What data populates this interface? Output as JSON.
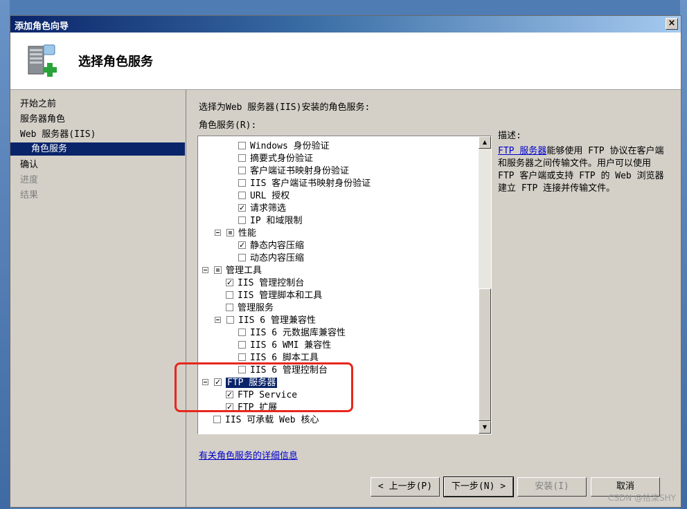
{
  "window": {
    "title": "添加角色向导",
    "close_label": "×"
  },
  "header": {
    "title": "选择角色服务"
  },
  "nav": {
    "items": [
      {
        "label": "开始之前",
        "state": "normal"
      },
      {
        "label": "服务器角色",
        "state": "normal"
      },
      {
        "label": "Web 服务器(IIS)",
        "state": "normal"
      },
      {
        "label": "角色服务",
        "state": "active"
      },
      {
        "label": "确认",
        "state": "normal"
      },
      {
        "label": "进度",
        "state": "disabled"
      },
      {
        "label": "结果",
        "state": "disabled"
      }
    ]
  },
  "main": {
    "intro": "选择为Web 服务器(IIS)安装的角色服务:",
    "tree_label": "角色服务(R):",
    "tree": [
      {
        "label": "Windows 身份验证",
        "state": "unchecked"
      },
      {
        "label": "摘要式身份验证",
        "state": "unchecked"
      },
      {
        "label": "客户端证书映射身份验证",
        "state": "unchecked"
      },
      {
        "label": "IIS 客户端证书映射身份验证",
        "state": "unchecked"
      },
      {
        "label": "URL 授权",
        "state": "unchecked"
      },
      {
        "label": "请求筛选",
        "state": "checked"
      },
      {
        "label": "IP 和域限制",
        "state": "unchecked"
      },
      {
        "label": "性能",
        "state": "partial"
      },
      {
        "label": "静态内容压缩",
        "state": "checked"
      },
      {
        "label": "动态内容压缩",
        "state": "unchecked"
      },
      {
        "label": "管理工具",
        "state": "partial"
      },
      {
        "label": "IIS 管理控制台",
        "state": "checked"
      },
      {
        "label": "IIS 管理脚本和工具",
        "state": "unchecked"
      },
      {
        "label": "管理服务",
        "state": "unchecked"
      },
      {
        "label": "IIS 6 管理兼容性",
        "state": "unchecked"
      },
      {
        "label": "IIS 6 元数据库兼容性",
        "state": "unchecked"
      },
      {
        "label": "IIS 6 WMI 兼容性",
        "state": "unchecked"
      },
      {
        "label": "IIS 6 脚本工具",
        "state": "unchecked"
      },
      {
        "label": "IIS 6 管理控制台",
        "state": "unchecked"
      },
      {
        "label": "FTP 服务器",
        "state": "checked",
        "selected": true
      },
      {
        "label": "FTP Service",
        "state": "checked"
      },
      {
        "label": "FTP 扩展",
        "state": "checked"
      },
      {
        "label": "IIS 可承载 Web 核心",
        "state": "unchecked"
      }
    ],
    "more_link": "有关角色服务的详细信息",
    "desc_title": "描述:",
    "desc_link": "FTP 服务器",
    "desc_text": "能够使用 FTP 协议在客户端和服务器之间传输文件。用户可以使用 FTP 客户端或支持 FTP 的 Web 浏览器建立 FTP 连接并传输文件。"
  },
  "buttons": {
    "prev": "< 上一步(P)",
    "next": "下一步(N) >",
    "install": "安装(I)",
    "cancel": "取消"
  },
  "watermark": "CSDN @拾柒SHY",
  "colors": {
    "highlight": "#e8261c",
    "selection": "#0a246a",
    "link": "#0000cc"
  }
}
